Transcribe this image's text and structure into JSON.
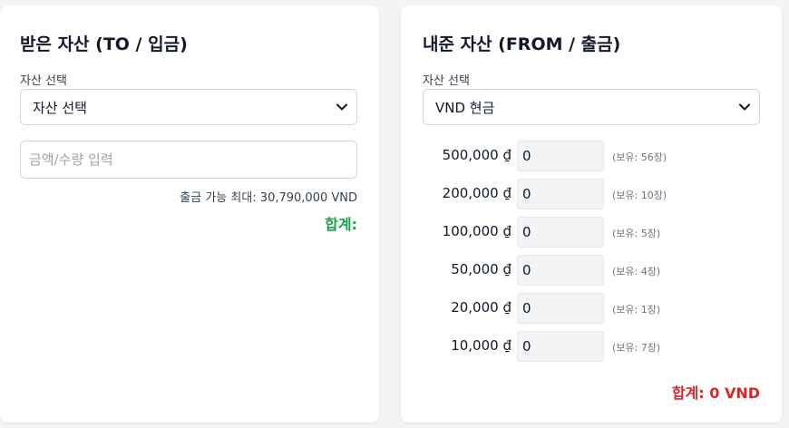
{
  "to_panel": {
    "title": "받은 자산 (TO / 입금)",
    "asset_label": "자산 선택",
    "asset_selected": "자산 선택",
    "amount_placeholder": "금액/수량 입력",
    "max_withdraw": "출금 가능 최대: 30,790,000 VND",
    "total_label": "합계:"
  },
  "from_panel": {
    "title": "내준 자산 (FROM / 출금)",
    "asset_label": "자산 선택",
    "asset_selected": "VND 현금",
    "denominations": [
      {
        "label": "500,000 ₫",
        "value": "0",
        "holding": "(보유: 56장)"
      },
      {
        "label": "200,000 ₫",
        "value": "0",
        "holding": "(보유: 10장)"
      },
      {
        "label": "100,000 ₫",
        "value": "0",
        "holding": "(보유: 5장)"
      },
      {
        "label": "50,000 ₫",
        "value": "0",
        "holding": "(보유: 4장)"
      },
      {
        "label": "20,000 ₫",
        "value": "0",
        "holding": "(보유: 1장)"
      },
      {
        "label": "10,000 ₫",
        "value": "0",
        "holding": "(보유: 7장)"
      }
    ],
    "total_label": "합계: 0 VND"
  },
  "colors": {
    "total_to": "#16a34a",
    "total_from": "#dc2626",
    "background": "#f3f4f6",
    "card": "#ffffff"
  }
}
